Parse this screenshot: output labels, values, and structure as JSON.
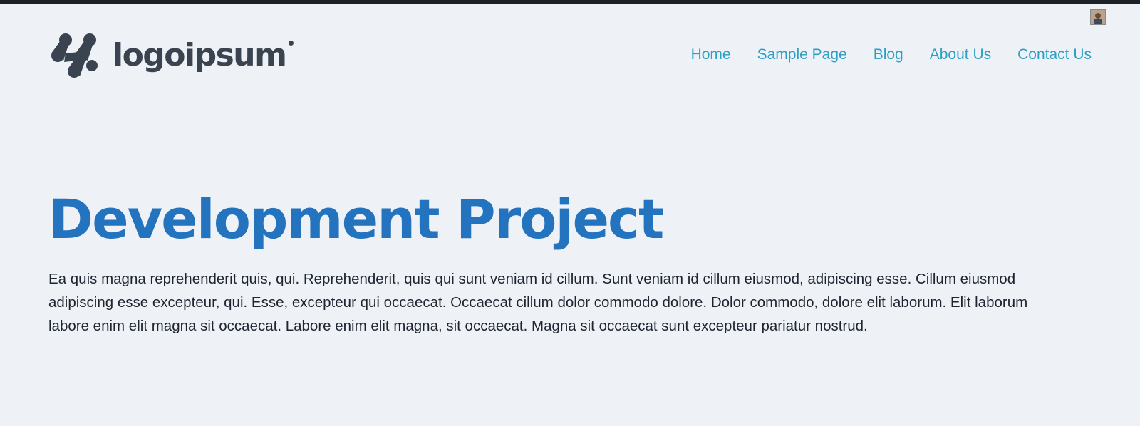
{
  "header": {
    "logo_text": "logoipsum",
    "nav": [
      {
        "label": "Home"
      },
      {
        "label": "Sample Page"
      },
      {
        "label": "Blog"
      },
      {
        "label": "About Us"
      },
      {
        "label": "Contact Us"
      }
    ]
  },
  "main": {
    "title": "Development Project",
    "paragraph": "Ea quis magna reprehenderit quis, qui. Reprehenderit, quis qui sunt veniam id cillum. Sunt veniam id cillum eiusmod, adipiscing esse. Cillum eiusmod adipiscing esse excepteur, qui. Esse, excepteur qui occaecat. Occaecat cillum dolor commodo dolore. Dolor commodo, dolore elit laborum. Elit laborum labore enim elit magna sit occaecat. Labore enim elit magna, sit occaecat. Magna sit occaecat sunt excepteur pariatur nostrud."
  },
  "colors": {
    "background": "#eef2f7",
    "top_bar": "#1d2127",
    "logo": "#3a4350",
    "nav_link": "#2c9fc4",
    "title": "#2373be",
    "body_text": "#1e2530"
  },
  "icons": {
    "logo_mark": "logo-mark-icon",
    "avatar": "user-avatar"
  }
}
